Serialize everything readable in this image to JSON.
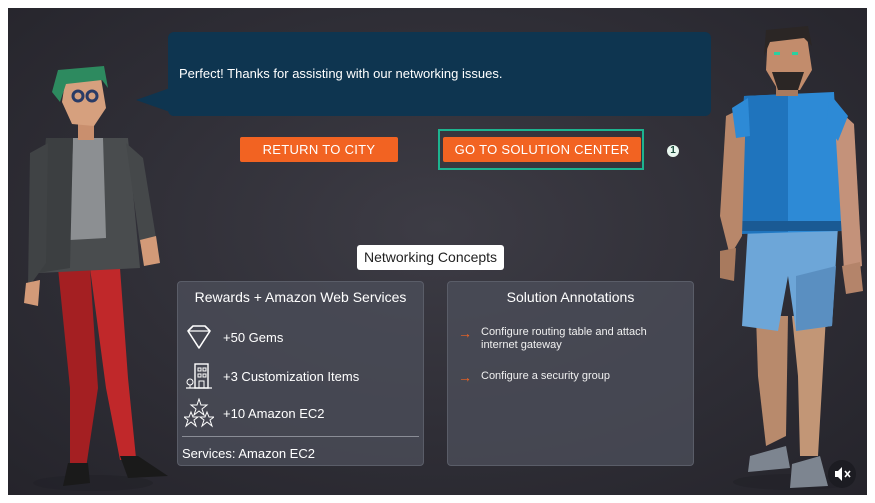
{
  "dialog": {
    "message": "Perfect! Thanks for assisting with our networking issues."
  },
  "buttons": {
    "return_label": "RETURN TO CITY",
    "solution_label": "GO TO SOLUTION CENTER",
    "step_badge": "1"
  },
  "concepts_label": "Networking Concepts",
  "rewards": {
    "title": "Rewards + Amazon Web Services",
    "items": [
      {
        "icon": "gem-icon",
        "label": "+50 Gems"
      },
      {
        "icon": "building-icon",
        "label": "+3 Customization Items"
      },
      {
        "icon": "stars-icon",
        "label": "+10 Amazon EC2"
      }
    ],
    "services": "Services: Amazon EC2"
  },
  "annotations": {
    "title": "Solution Annotations",
    "items": [
      {
        "arrow": "→",
        "text": "Configure routing table and attach internet gateway"
      },
      {
        "arrow": "→",
        "text": "Configure a security group"
      }
    ]
  },
  "colors": {
    "accent": "#f26322",
    "dialog_bg": "#0e3550",
    "highlight": "#1db38f",
    "background": "#2f2e36"
  },
  "icons": {
    "mute": "speaker-muted-icon"
  }
}
